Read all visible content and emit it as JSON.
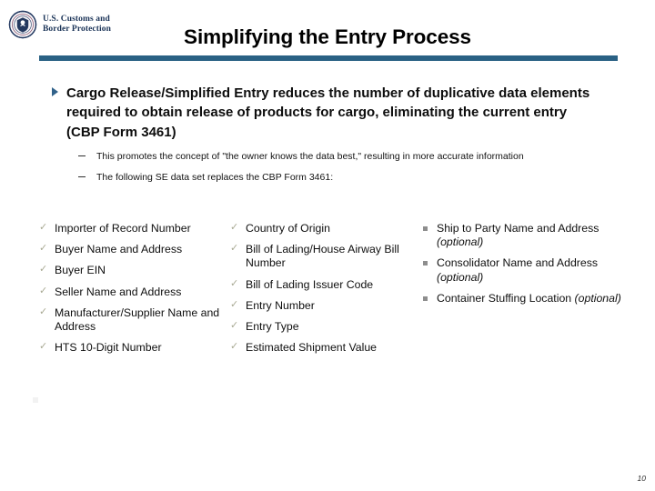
{
  "header": {
    "logo": {
      "icon": "dhs-cbp-seal-icon",
      "line1": "U.S. Customs and",
      "line2": "Border Protection"
    },
    "title": "Simplifying the Entry Process",
    "rule_color": "#2a6184"
  },
  "body": {
    "main_bullet": {
      "marker": "triangle-right-icon",
      "text": "Cargo Release/Simplified Entry reduces the number of duplicative data elements required to obtain release of products for cargo, eliminating the current entry (CBP Form 3461)"
    },
    "sub_bullets": [
      {
        "marker": "dash-icon",
        "text": "This promotes the concept of \"the owner knows the data best,\" resulting in more accurate information"
      },
      {
        "marker": "dash-icon",
        "text": "The following SE data set replaces the CBP Form 3461:"
      }
    ]
  },
  "dataset": {
    "columns": [
      {
        "marker": "check-icon",
        "items": [
          {
            "text": "Importer of Record Number",
            "optional": ""
          },
          {
            "text": "Buyer Name and Address",
            "optional": ""
          },
          {
            "text": "Buyer EIN",
            "optional": ""
          },
          {
            "text": "Seller Name and Address",
            "optional": ""
          },
          {
            "text": "Manufacturer/Supplier Name and Address",
            "optional": ""
          },
          {
            "text": "HTS 10-Digit Number",
            "optional": ""
          }
        ]
      },
      {
        "marker": "check-icon",
        "items": [
          {
            "text": "Country of Origin",
            "optional": ""
          },
          {
            "text": "Bill of Lading/House Airway Bill Number",
            "optional": ""
          },
          {
            "text": "Bill of Lading Issuer Code",
            "optional": ""
          },
          {
            "text": "Entry Number",
            "optional": ""
          },
          {
            "text": "Entry Type",
            "optional": ""
          },
          {
            "text": "Estimated Shipment Value",
            "optional": ""
          }
        ]
      },
      {
        "marker": "square-bullet-icon",
        "items": [
          {
            "text": "Ship to Party Name and Address ",
            "optional": "(optional)"
          },
          {
            "text": "Consolidator Name and Address ",
            "optional": "(optional)"
          },
          {
            "text": "Container Stuffing Location ",
            "optional": "(optional)"
          }
        ]
      }
    ]
  },
  "footer": {
    "page_number": "10"
  },
  "glyphs": {
    "check": "✓"
  }
}
